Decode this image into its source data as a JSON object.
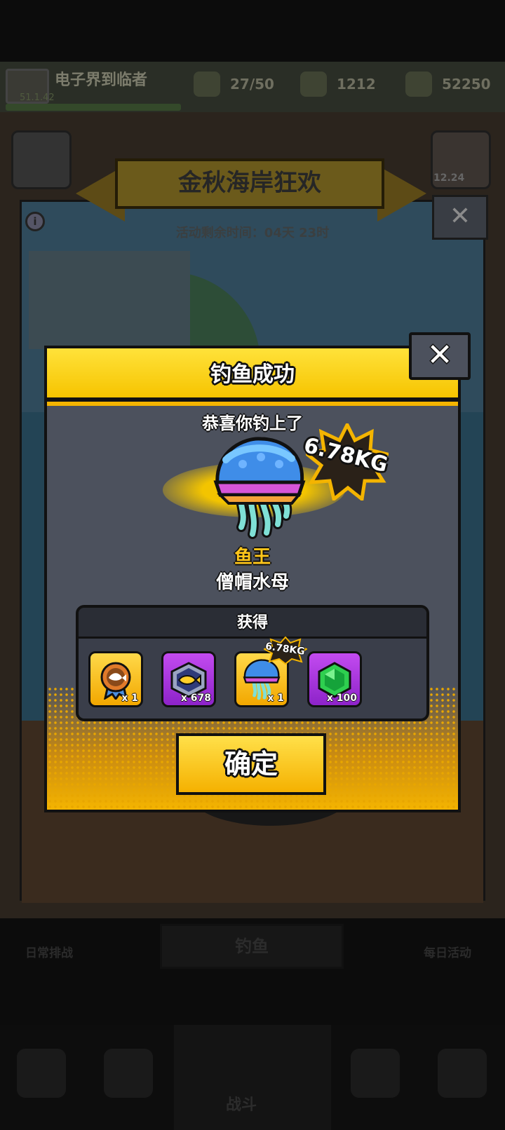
{
  "topbar": {
    "player_name": "电子界到临者",
    "player_sub": "51.1.42",
    "resources": [
      {
        "icon": "stamina-icon",
        "value": "27/50"
      },
      {
        "icon": "medal-icon",
        "value": "1212"
      },
      {
        "icon": "coin-icon",
        "value": "52250"
      }
    ]
  },
  "event": {
    "title": "金秋海岸狂欢",
    "timer": "活动剩余时间：04天 23时",
    "side_right_label": "12.24"
  },
  "modal": {
    "title": "钓鱼成功",
    "close_glyph": "✕",
    "congrats": "恭喜你钓上了",
    "weight": "6.78KG",
    "rarity": "鱼王",
    "fish_name": "僧帽水母",
    "rewards_header": "获得",
    "rewards": [
      {
        "icon": "fish-medal-icon",
        "style": "gold",
        "count": "x 1"
      },
      {
        "icon": "fish-token-icon",
        "style": "purple",
        "count": "x 678"
      },
      {
        "icon": "jellyfish-icon",
        "style": "gold",
        "count": "x 1",
        "badge": "6.78KG"
      },
      {
        "icon": "green-gem-icon",
        "style": "purple",
        "count": "x 100"
      }
    ],
    "confirm_label": "确定"
  },
  "bottom": {
    "left_label": "日常排战",
    "center_label": "钓鱼",
    "right_label": "每日活动",
    "nav_center_label": "战斗"
  },
  "colors": {
    "accent_yellow": "#f4b400",
    "panel_gray": "#4c515d",
    "rarity_gold": "#ffc61a",
    "reward_purple": "#a634dd"
  }
}
